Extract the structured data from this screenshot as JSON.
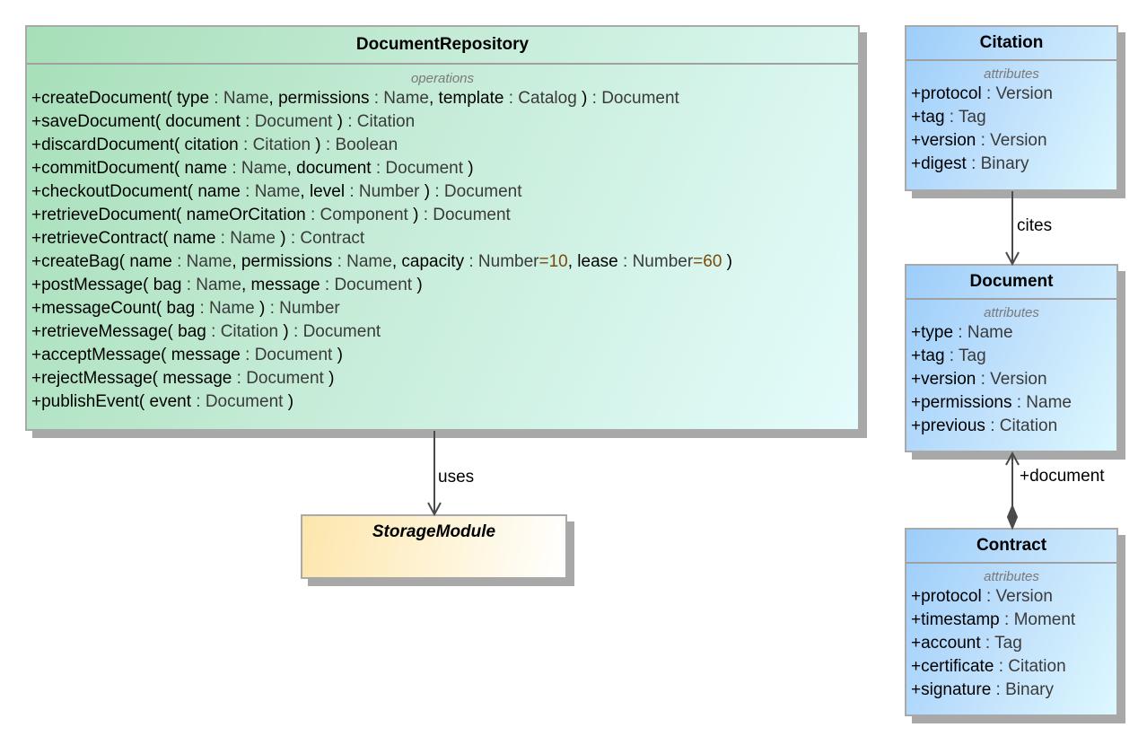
{
  "classes": {
    "document_repository": {
      "name": "DocumentRepository",
      "section": "operations",
      "operations": [
        [
          {
            "t": "n",
            "v": "+createDocument( type "
          },
          {
            "t": "t",
            "v": ": Name"
          },
          {
            "t": "n",
            "v": ", permissions "
          },
          {
            "t": "t",
            "v": ": Name"
          },
          {
            "t": "n",
            "v": ", template "
          },
          {
            "t": "t",
            "v": ": Catalog"
          },
          {
            "t": "n",
            "v": " ) "
          },
          {
            "t": "t",
            "v": ": Document"
          }
        ],
        [
          {
            "t": "n",
            "v": "+saveDocument( document "
          },
          {
            "t": "t",
            "v": ": Document"
          },
          {
            "t": "n",
            "v": " ) "
          },
          {
            "t": "t",
            "v": ": Citation"
          }
        ],
        [
          {
            "t": "n",
            "v": "+discardDocument( citation "
          },
          {
            "t": "t",
            "v": ": Citation"
          },
          {
            "t": "n",
            "v": " ) "
          },
          {
            "t": "t",
            "v": ": Boolean"
          }
        ],
        [
          {
            "t": "n",
            "v": "+commitDocument( name "
          },
          {
            "t": "t",
            "v": ": Name"
          },
          {
            "t": "n",
            "v": ", document "
          },
          {
            "t": "t",
            "v": ": Document"
          },
          {
            "t": "n",
            "v": " )"
          }
        ],
        [
          {
            "t": "n",
            "v": "+checkoutDocument( name "
          },
          {
            "t": "t",
            "v": ": Name"
          },
          {
            "t": "n",
            "v": ", level "
          },
          {
            "t": "t",
            "v": ": Number"
          },
          {
            "t": "n",
            "v": " ) "
          },
          {
            "t": "t",
            "v": ": Document"
          }
        ],
        [
          {
            "t": "n",
            "v": "+retrieveDocument( nameOrCitation "
          },
          {
            "t": "t",
            "v": ": Component"
          },
          {
            "t": "n",
            "v": " ) "
          },
          {
            "t": "t",
            "v": ": Document"
          }
        ],
        [
          {
            "t": "n",
            "v": "+retrieveContract( name "
          },
          {
            "t": "t",
            "v": ": Name"
          },
          {
            "t": "n",
            "v": " ) "
          },
          {
            "t": "t",
            "v": ": Contract"
          }
        ],
        [
          {
            "t": "n",
            "v": "+createBag( name "
          },
          {
            "t": "t",
            "v": ": Name"
          },
          {
            "t": "n",
            "v": ", permissions "
          },
          {
            "t": "t",
            "v": ": Name"
          },
          {
            "t": "n",
            "v": ", capacity "
          },
          {
            "t": "t",
            "v": ": Number"
          },
          {
            "t": "d",
            "v": "=10"
          },
          {
            "t": "n",
            "v": ", lease "
          },
          {
            "t": "t",
            "v": ": Number"
          },
          {
            "t": "d",
            "v": "=60"
          },
          {
            "t": "n",
            "v": " )"
          }
        ],
        [
          {
            "t": "n",
            "v": "+postMessage( bag "
          },
          {
            "t": "t",
            "v": ": Name"
          },
          {
            "t": "n",
            "v": ", message "
          },
          {
            "t": "t",
            "v": ": Document"
          },
          {
            "t": "n",
            "v": " )"
          }
        ],
        [
          {
            "t": "n",
            "v": "+messageCount( bag "
          },
          {
            "t": "t",
            "v": ": Name"
          },
          {
            "t": "n",
            "v": " ) "
          },
          {
            "t": "t",
            "v": ": Number"
          }
        ],
        [
          {
            "t": "n",
            "v": "+retrieveMessage( bag "
          },
          {
            "t": "t",
            "v": ": Citation"
          },
          {
            "t": "n",
            "v": " ) "
          },
          {
            "t": "t",
            "v": ": Document"
          }
        ],
        [
          {
            "t": "n",
            "v": "+acceptMessage( message "
          },
          {
            "t": "t",
            "v": ": Document"
          },
          {
            "t": "n",
            "v": " )"
          }
        ],
        [
          {
            "t": "n",
            "v": "+rejectMessage( message "
          },
          {
            "t": "t",
            "v": ": Document"
          },
          {
            "t": "n",
            "v": " )"
          }
        ],
        [
          {
            "t": "n",
            "v": "+publishEvent( event "
          },
          {
            "t": "t",
            "v": ": Document"
          },
          {
            "t": "n",
            "v": " )"
          }
        ]
      ]
    },
    "storage_module": {
      "name": "StorageModule"
    },
    "citation": {
      "name": "Citation",
      "section": "attributes",
      "attributes": [
        {
          "name": "+protocol ",
          "type": ": Version"
        },
        {
          "name": "+tag ",
          "type": ": Tag"
        },
        {
          "name": "+version ",
          "type": ": Version"
        },
        {
          "name": "+digest ",
          "type": ": Binary"
        }
      ]
    },
    "document": {
      "name": "Document",
      "section": "attributes",
      "attributes": [
        {
          "name": "+type ",
          "type": ": Name"
        },
        {
          "name": "+tag ",
          "type": ": Tag"
        },
        {
          "name": "+version ",
          "type": ": Version"
        },
        {
          "name": "+permissions ",
          "type": ": Name"
        },
        {
          "name": "+previous ",
          "type": ": Citation"
        }
      ]
    },
    "contract": {
      "name": "Contract",
      "section": "attributes",
      "attributes": [
        {
          "name": "+protocol ",
          "type": ": Version"
        },
        {
          "name": "+timestamp ",
          "type": ": Moment"
        },
        {
          "name": "+account ",
          "type": ": Tag"
        },
        {
          "name": "+certificate ",
          "type": ": Citation"
        },
        {
          "name": "+signature ",
          "type": ": Binary"
        }
      ]
    }
  },
  "relations": {
    "uses": "uses",
    "cites": "cites",
    "document_role": "+document"
  },
  "colors": {
    "type_text": "#3a3a3a",
    "default_value": "#7a4a0a",
    "section_label": "#7a7a7a"
  }
}
